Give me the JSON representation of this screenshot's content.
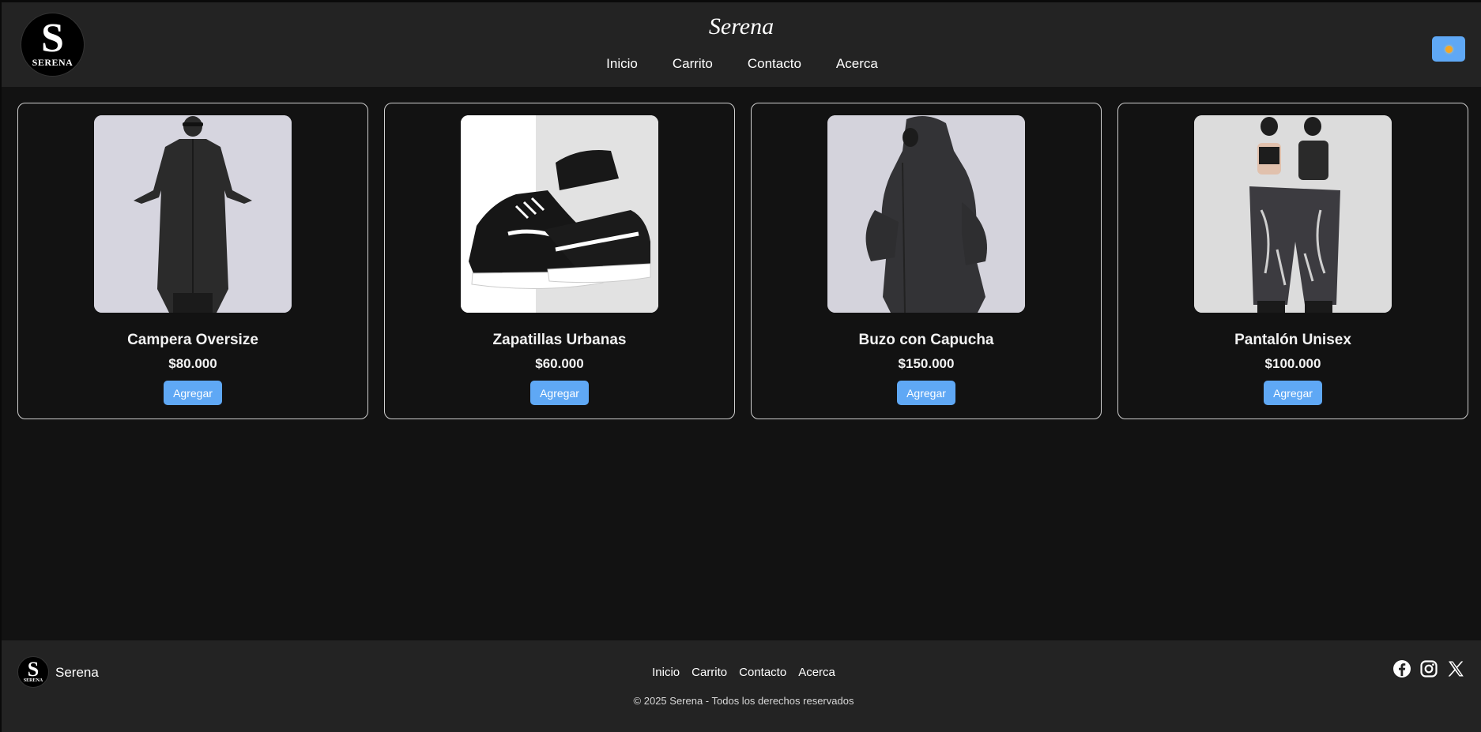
{
  "header": {
    "logo_letter": "S",
    "logo_text": "SERENA",
    "brand": "Serena",
    "nav": [
      "Inicio",
      "Carrito",
      "Contacto",
      "Acerca"
    ],
    "theme_icon": "sun-icon"
  },
  "products": [
    {
      "name": "Campera Oversize",
      "price": "$80.000",
      "button": "Agregar"
    },
    {
      "name": "Zapatillas Urbanas",
      "price": "$60.000",
      "button": "Agregar"
    },
    {
      "name": "Buzo con Capucha",
      "price": "$150.000",
      "button": "Agregar"
    },
    {
      "name": "Pantalón Unisex",
      "price": "$100.000",
      "button": "Agregar"
    }
  ],
  "footer": {
    "logo_letter": "S",
    "logo_text": "SERENA",
    "brand": "Serena",
    "nav": [
      "Inicio",
      "Carrito",
      "Contacto",
      "Acerca"
    ],
    "copyright": "© 2025 Serena - Todos los derechos reservados",
    "social_icons": [
      "facebook-icon",
      "instagram-icon",
      "x-icon"
    ]
  },
  "colors": {
    "background": "#121212",
    "header": "#232323",
    "accent": "#5fa8f5"
  }
}
